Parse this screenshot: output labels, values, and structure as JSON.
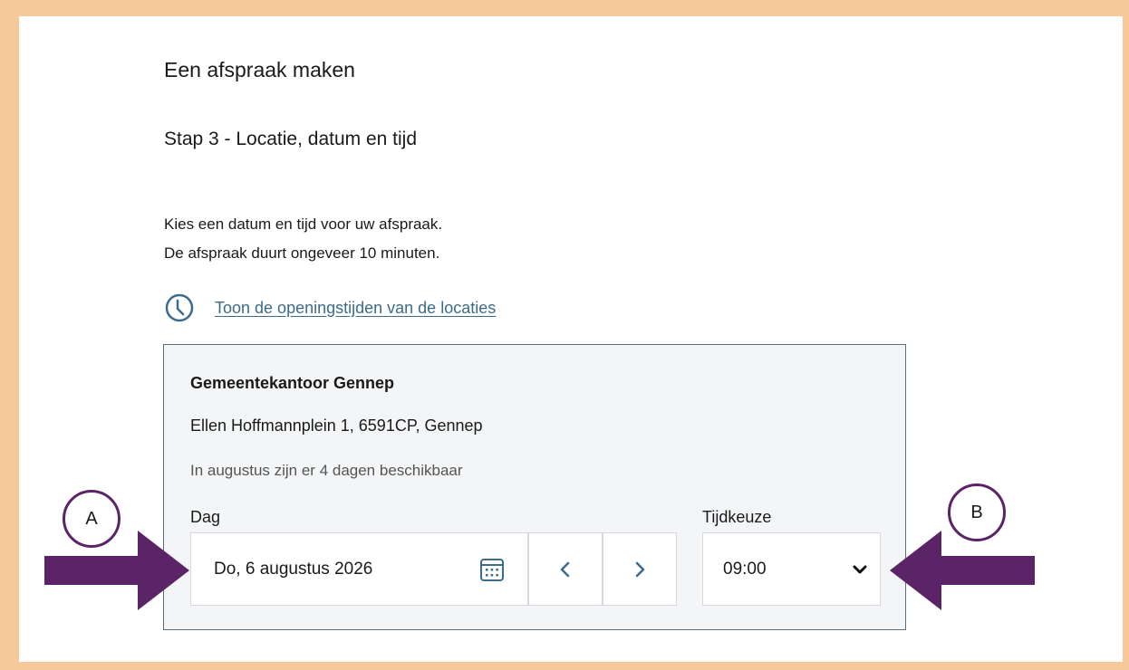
{
  "page": {
    "title": "Een afspraak maken",
    "step": "Stap 3 - Locatie, datum en tijd",
    "intro_line1": "Kies een datum en tijd voor uw afspraak.",
    "intro_line2": "De afspraak duurt ongeveer 10 minuten.",
    "hours_link": "Toon de openingstijden van de locaties"
  },
  "location": {
    "name": "Gemeentekantoor Gennep",
    "address": "Ellen Hoffmannplein 1, 6591CP, Gennep",
    "availability": "In augustus zijn er 4 dagen beschikbaar"
  },
  "date_picker": {
    "label": "Dag",
    "value": "Do, 6 augustus 2026"
  },
  "time_picker": {
    "label": "Tijdkeuze",
    "value": "09:00"
  },
  "annotations": {
    "marker_a": "A",
    "marker_b": "B"
  },
  "colors": {
    "frame": "#f7c99a",
    "annotation": "#5b2466",
    "link": "#3d6b8a"
  }
}
